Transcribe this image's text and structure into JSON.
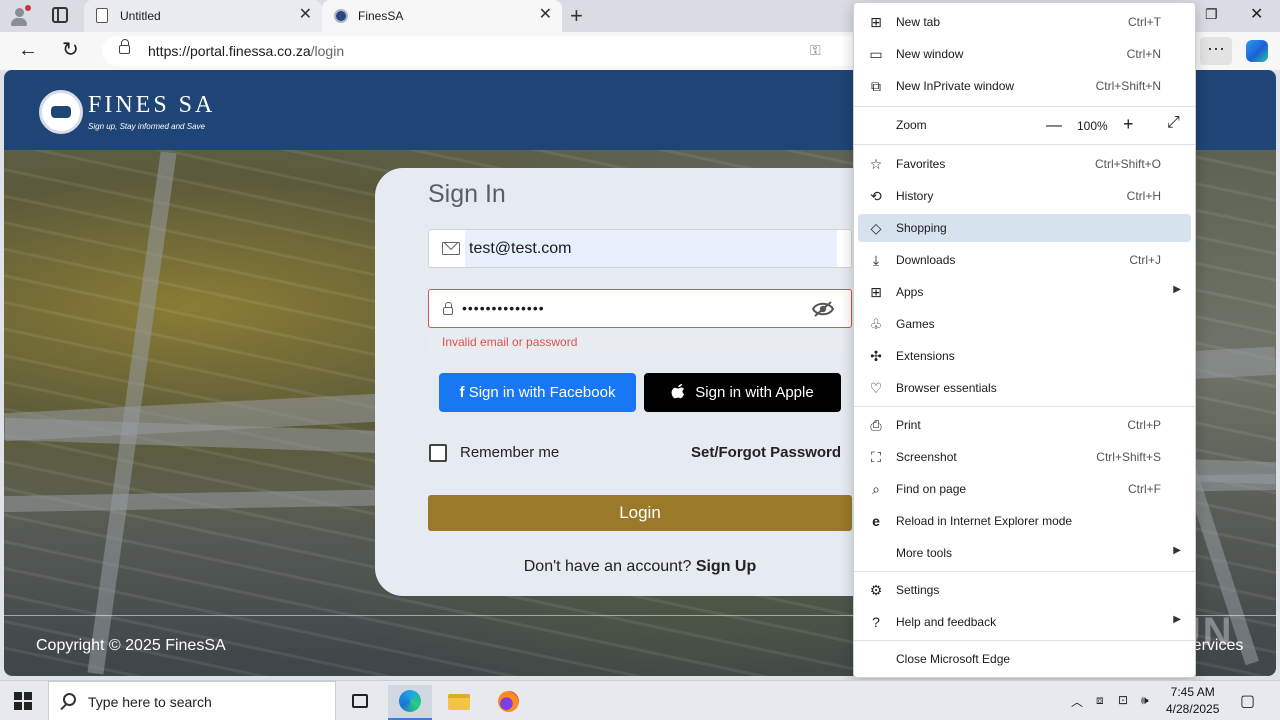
{
  "browser": {
    "tabs": [
      {
        "title": "Untitled"
      },
      {
        "title": "FinesSA"
      }
    ],
    "url_host": "https://portal.finessa.co.za",
    "url_path": "/login"
  },
  "site": {
    "logo_text": "FINES SA",
    "logo_tagline": "Sign up, Stay informed and Save",
    "copyright": "Copyright © 2025 FinesSA",
    "footer_right": "Services"
  },
  "signin": {
    "title": "Sign In",
    "email_value": "test@test.com",
    "password_value": "••••••••••••••",
    "error": "Invalid email or password",
    "facebook_label": "Sign in with Facebook",
    "apple_label": "Sign in with Apple",
    "remember_label": "Remember me",
    "forgot_label": "Set/Forgot Password",
    "login_label": "Login",
    "signup_prompt": "Don't have an account?",
    "signup_link": "Sign Up"
  },
  "menu": {
    "items": [
      {
        "label": "New tab",
        "shortcut": "Ctrl+T",
        "icon": "new-tab-icon"
      },
      {
        "label": "New window",
        "shortcut": "Ctrl+N",
        "icon": "window-icon"
      },
      {
        "label": "New InPrivate window",
        "shortcut": "Ctrl+Shift+N",
        "icon": "inprivate-icon"
      },
      {
        "label": "Zoom",
        "shortcut": "",
        "icon": ""
      },
      {
        "label": "Favorites",
        "shortcut": "Ctrl+Shift+O",
        "icon": "star-icon"
      },
      {
        "label": "History",
        "shortcut": "Ctrl+H",
        "icon": "history-icon"
      },
      {
        "label": "Shopping",
        "shortcut": "",
        "icon": "tag-icon"
      },
      {
        "label": "Downloads",
        "shortcut": "Ctrl+J",
        "icon": "download-icon"
      },
      {
        "label": "Apps",
        "shortcut": "",
        "icon": "apps-icon"
      },
      {
        "label": "Games",
        "shortcut": "",
        "icon": "games-icon"
      },
      {
        "label": "Extensions",
        "shortcut": "",
        "icon": "puzzle-icon"
      },
      {
        "label": "Browser essentials",
        "shortcut": "",
        "icon": "heart-pulse-icon"
      },
      {
        "label": "Print",
        "shortcut": "Ctrl+P",
        "icon": "print-icon"
      },
      {
        "label": "Screenshot",
        "shortcut": "Ctrl+Shift+S",
        "icon": "screenshot-icon"
      },
      {
        "label": "Find on page",
        "shortcut": "Ctrl+F",
        "icon": "find-icon"
      },
      {
        "label": "Reload in Internet Explorer mode",
        "shortcut": "",
        "icon": "ie-icon"
      },
      {
        "label": "More tools",
        "shortcut": "",
        "icon": ""
      },
      {
        "label": "Settings",
        "shortcut": "",
        "icon": "gear-icon"
      },
      {
        "label": "Help and feedback",
        "shortcut": "",
        "icon": "help-icon"
      },
      {
        "label": "Close Microsoft Edge",
        "shortcut": "",
        "icon": ""
      }
    ],
    "zoom_value": "100%"
  },
  "taskbar": {
    "search_placeholder": "Type here to search",
    "time": "7:45 AM",
    "date": "4/28/2025"
  },
  "watermark": "ANY RUN"
}
